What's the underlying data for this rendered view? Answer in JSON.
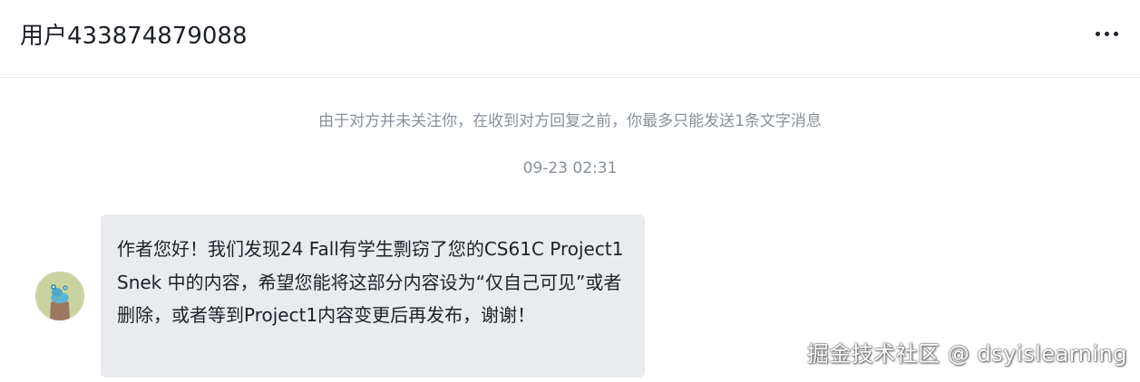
{
  "header": {
    "title": "用户433874879088",
    "more_icon": "more-dots-icon"
  },
  "chat": {
    "notice": "由于对方并未关注你，在收到对方回复之前，你最多只能发送1条文字消息",
    "timestamp": "09-23 02:31",
    "message": {
      "text": "作者您好！我们发现24 Fall有学生剽窃了您的CS61C Project1 Snek 中的内容，希望您能将这部分内容设为“仅自己可见”或者删除，或者等到Project1内容变更后再发布，谢谢！",
      "avatar_icon": "avatar-icon"
    }
  },
  "watermark": "掘金技术社区 @ dsyislearning",
  "colors": {
    "bubble_bg": "#e9ebee",
    "muted_text": "#86909c",
    "primary_text": "#1d2129",
    "divider": "#e8eaed"
  }
}
